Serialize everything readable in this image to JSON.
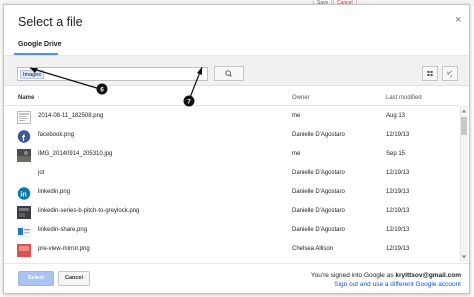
{
  "background": {
    "save_label": "Save",
    "cancel_label": "Cancel"
  },
  "dialog": {
    "title": "Select a file",
    "close_glyph": "×",
    "tab_label": "Google Drive",
    "search_chip": "Images",
    "columns": {
      "name": "Name",
      "sort_glyph": "↑",
      "owner": "Owner",
      "modified": "Last modified"
    },
    "files": [
      {
        "name": "2014-08-11_182508.png",
        "owner": "me",
        "modified": "Aug 13",
        "thumb": "screenshot-thumb"
      },
      {
        "name": "facebook.png",
        "owner": "Danielle D'Agostaro",
        "modified": "12/19/13",
        "thumb": "facebook-thumb"
      },
      {
        "name": "IMG_20140914_205310.jpg",
        "owner": "me",
        "modified": "Sep 15",
        "thumb": "photo-thumb"
      },
      {
        "name": "jot",
        "owner": "Danielle D'Agostaro",
        "modified": "12/19/13",
        "thumb": "blank-thumb"
      },
      {
        "name": "linkedin.png",
        "owner": "Danielle D'Agostaro",
        "modified": "12/19/13",
        "thumb": "linkedin-thumb"
      },
      {
        "name": "linkedin-series-b-pitch-to-greylock.png",
        "owner": "Danielle D'Agostaro",
        "modified": "12/19/13",
        "thumb": "slide-thumb"
      },
      {
        "name": "linkedin-share.png",
        "owner": "Danielle D'Agostaro",
        "modified": "12/19/13",
        "thumb": "share-thumb"
      },
      {
        "name": "pre-view-mirror.png",
        "owner": "Chelsea Allison",
        "modified": "12/19/13",
        "thumb": "preview-thumb"
      }
    ],
    "footer": {
      "select_label": "Select",
      "cancel_label": "Cancel",
      "signed_in_prefix": "You're signed into Google as ",
      "signed_in_email": "krylttsov@gmail.com",
      "signout_text": "Sign out and use a different Google account"
    }
  },
  "annotations": {
    "marker_6": "6",
    "marker_7": "7"
  },
  "colors": {
    "accent": "#4d90fe",
    "link": "#1155cc",
    "select_button": "#a9c4f3",
    "facebook": "#3b5998",
    "linkedin": "#0e76a8"
  }
}
